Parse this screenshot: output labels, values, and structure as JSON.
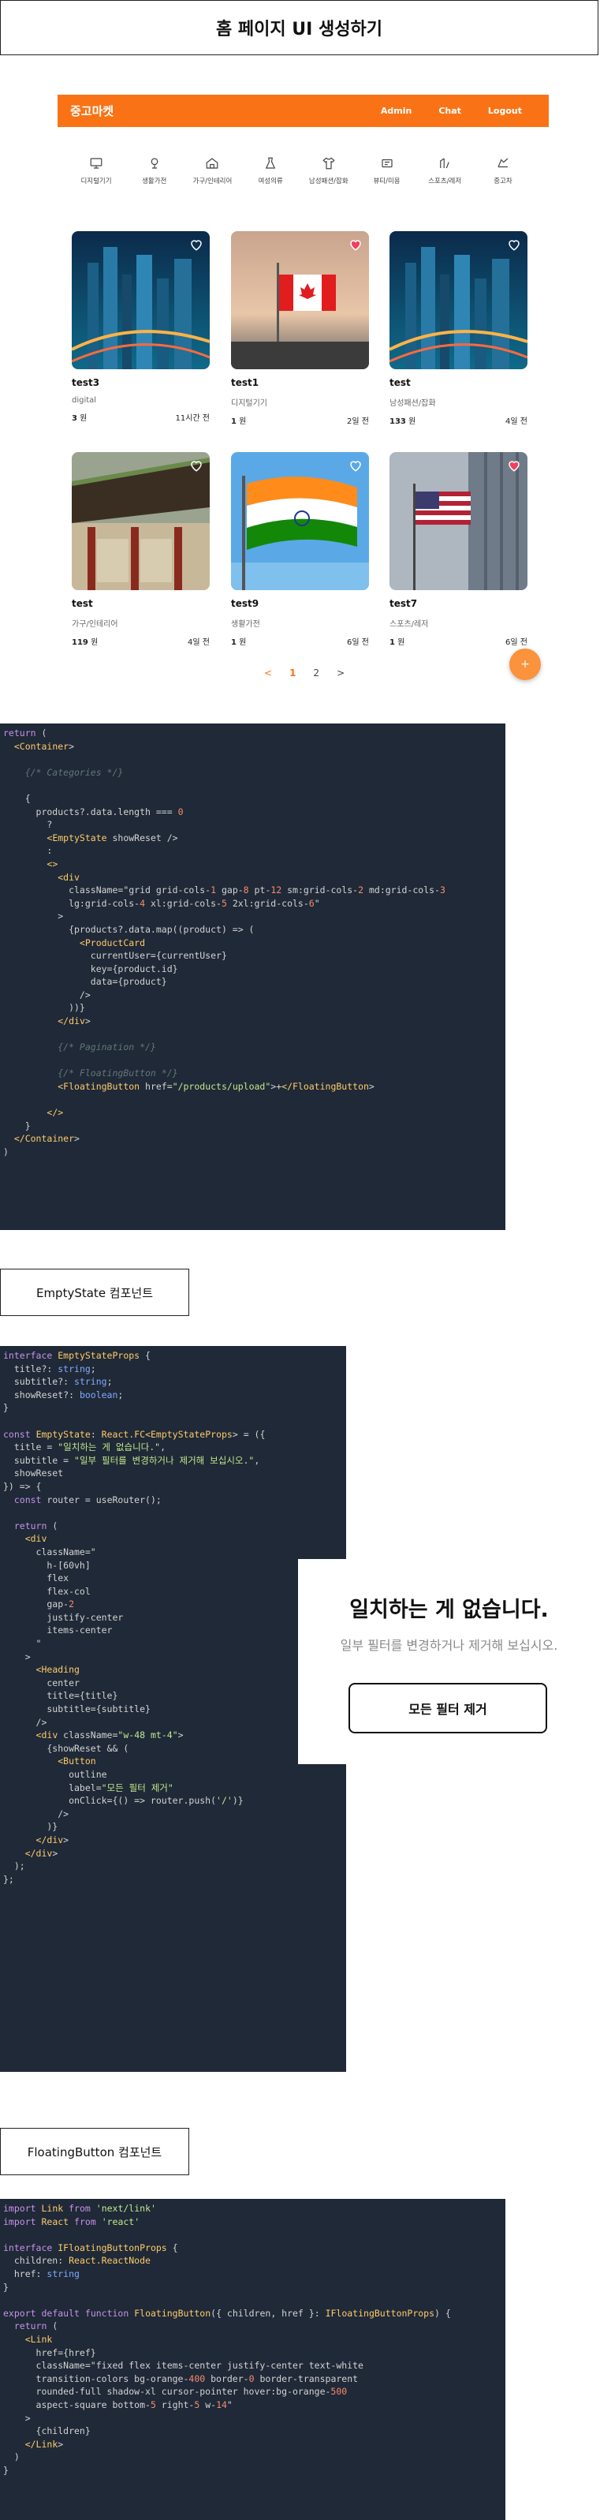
{
  "header": {
    "title": "홈 페이지 UI 생성하기"
  },
  "preview": {
    "brand": "중고마켓",
    "nav": [
      "Admin",
      "Chat",
      "Logout"
    ],
    "categories": [
      {
        "label": "디지털기기",
        "icon": "computer-icon"
      },
      {
        "label": "생활가전",
        "icon": "appliance-icon"
      },
      {
        "label": "가구/인테리어",
        "icon": "furniture-icon"
      },
      {
        "label": "여성의류",
        "icon": "dress-icon"
      },
      {
        "label": "남성패션/잡화",
        "icon": "shirt-icon"
      },
      {
        "label": "뷰티/미용",
        "icon": "beauty-icon"
      },
      {
        "label": "스포츠/레저",
        "icon": "sports-icon"
      },
      {
        "label": "중고차",
        "icon": "car-icon"
      }
    ],
    "products": [
      {
        "title": "test3",
        "category": "digital",
        "price": "3",
        "unit": "원",
        "time": "11시간 전",
        "liked": false,
        "image": "city-night"
      },
      {
        "title": "test1",
        "category": "디지털기기",
        "price": "1",
        "unit": "원",
        "time": "2일 전",
        "liked": true,
        "image": "canada-flag"
      },
      {
        "title": "test",
        "category": "남성패션/잡화",
        "price": "133",
        "unit": "원",
        "time": "4일 전",
        "liked": false,
        "image": "city-night"
      },
      {
        "title": "test",
        "category": "가구/인테리어",
        "price": "119",
        "unit": "원",
        "time": "4일 전",
        "liked": false,
        "image": "temple"
      },
      {
        "title": "test9",
        "category": "생활가전",
        "price": "1",
        "unit": "원",
        "time": "6일 전",
        "liked": false,
        "image": "india-flag"
      },
      {
        "title": "test7",
        "category": "스포츠/레저",
        "price": "1",
        "unit": "원",
        "time": "6일 전",
        "liked": true,
        "image": "us-flag"
      }
    ],
    "pager": {
      "prev": "<",
      "pages": [
        "1",
        "2"
      ],
      "next": ">"
    },
    "fab": "+"
  },
  "code1": [
    "return (",
    "  <Container>",
    "",
    "    {/* Categories */}",
    "",
    "    {",
    "      products?.data.length === 0",
    "        ?",
    "        <EmptyState showReset />",
    "        :",
    "        <>",
    "          <div",
    "            className=\"grid grid-cols-1 gap-8 pt-12 sm:grid-cols-2 md:grid-cols-3",
    "            lg:grid-cols-4 xl:grid-cols-5 2xl:grid-cols-6\"",
    "          >",
    "            {products?.data.map((product) => (",
    "              <ProductCard",
    "                currentUser={currentUser}",
    "                key={product.id}",
    "                data={product}",
    "              />",
    "            ))}",
    "          </div>",
    "",
    "          {/* Pagination */}",
    "",
    "          {/* FloatingButton */}",
    "          <FloatingButton href=\"/products/upload\">+</FloatingButton>",
    "",
    "        </>",
    "    }",
    "  </Container>",
    ")"
  ],
  "label2": "EmptyState 컴포넌트",
  "code2": [
    "interface EmptyStateProps {",
    "  title?: string;",
    "  subtitle?: string;",
    "  showReset?: boolean;",
    "}",
    "",
    "const EmptyState: React.FC<EmptyStateProps> = ({",
    "  title = \"일치하는 게 없습니다.\",",
    "  subtitle = \"일부 필터를 변경하거나 제거해 보십시오.\",",
    "  showReset",
    "}) => {",
    "  const router = useRouter();",
    "",
    "  return (",
    "    <div",
    "      className=\"",
    "        h-[60vh]",
    "        flex",
    "        flex-col",
    "        gap-2",
    "        justify-center",
    "        items-center",
    "      \"",
    "    >",
    "      <Heading",
    "        center",
    "        title={title}",
    "        subtitle={subtitle}",
    "      />",
    "      <div className=\"w-48 mt-4\">",
    "        {showReset && (",
    "          <Button",
    "            outline",
    "            label=\"모든 필터 제거\"",
    "            onClick={() => router.push('/')}",
    "          />",
    "        )}",
    "      </div>",
    "    </div>",
    "  );",
    "};"
  ],
  "empty_preview": {
    "title": "일치하는 게 없습니다.",
    "subtitle": "일부 필터를 변경하거나 제거해 보십시오.",
    "button": "모든 필터 제거"
  },
  "label3": "FloatingButton 컴포넌트",
  "code3": [
    "import Link from 'next/link'",
    "import React from 'react'",
    "",
    "interface IFloatingButtonProps {",
    "  children: React.ReactNode",
    "  href: string",
    "}",
    "",
    "export default function FloatingButton({ children, href }: IFloatingButtonProps) {",
    "  return (",
    "    <Link",
    "      href={href}",
    "      className=\"fixed flex items-center justify-center text-white",
    "      transition-colors bg-orange-400 border-0 border-transparent",
    "      rounded-full shadow-xl cursor-pointer hover:bg-orange-500",
    "      aspect-square bottom-5 right-5 w-14\"",
    "    >",
    "      {children}",
    "    </Link>",
    "  )",
    "}"
  ]
}
